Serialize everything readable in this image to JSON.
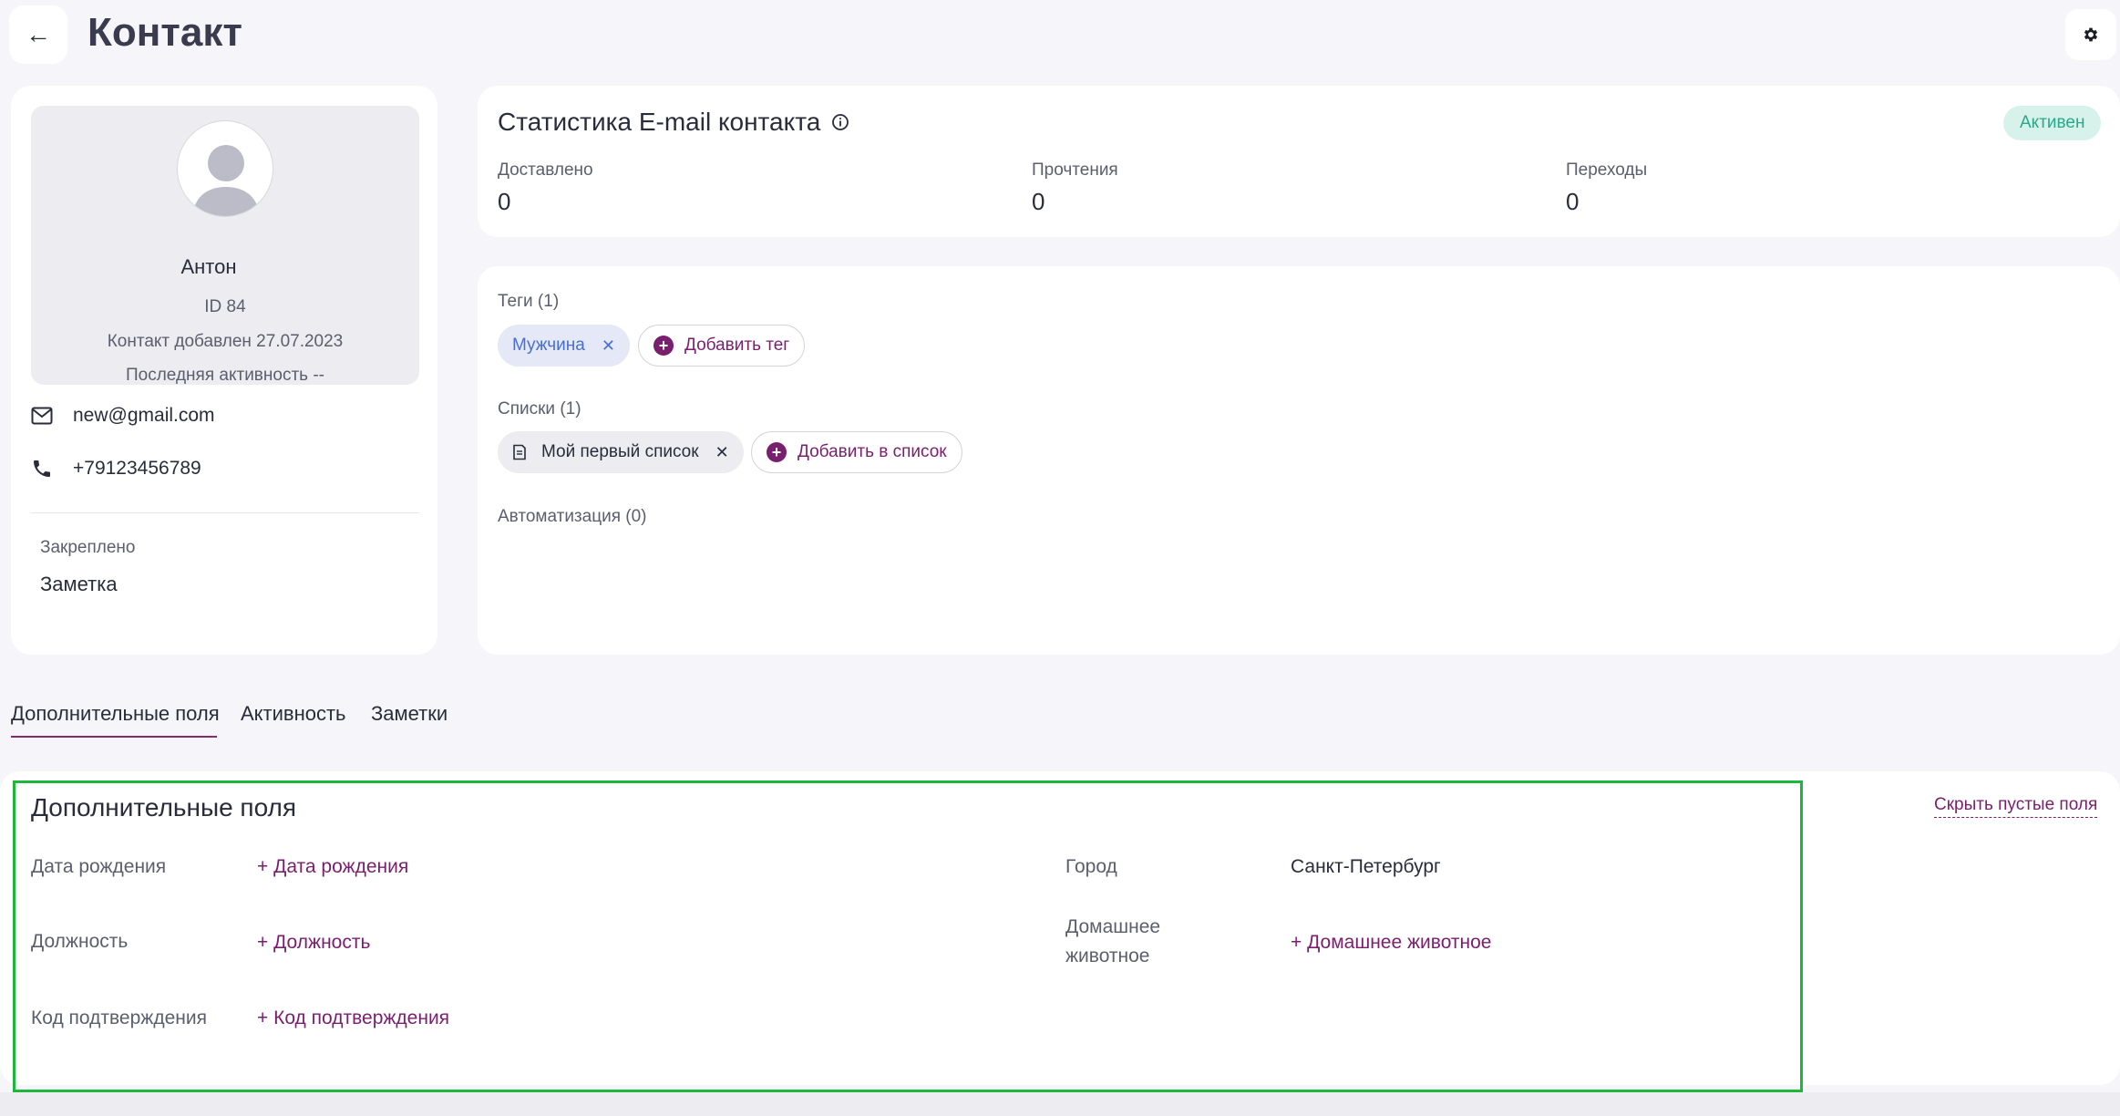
{
  "header": {
    "back_icon": "←",
    "title": "Контакт"
  },
  "profile": {
    "name": "Антон",
    "id": "ID 84",
    "added": "Контакт добавлен 27.07.2023",
    "last_activity": "Последняя активность --",
    "email": "new@gmail.com",
    "phone": "+79123456789",
    "pinned_label": "Закреплено",
    "pinned_value": "Заметка"
  },
  "stats": {
    "title": "Статистика E-mail контакта",
    "status": "Активен",
    "items": [
      {
        "label": "Доставлено",
        "value": "0"
      },
      {
        "label": "Прочтения",
        "value": "0"
      },
      {
        "label": "Переходы",
        "value": "0"
      }
    ]
  },
  "tags": {
    "label": "Теги (1)",
    "items": [
      "Мужчина"
    ],
    "add_label": "Добавить тег"
  },
  "lists": {
    "label": "Списки (1)",
    "items": [
      "Мой первый список"
    ],
    "add_label": "Добавить в список"
  },
  "automation": {
    "label": "Автоматизация (0)"
  },
  "tabs": [
    {
      "label": "Дополнительные поля",
      "active": true
    },
    {
      "label": "Активность"
    },
    {
      "label": "Заметки"
    }
  ],
  "extra_fields": {
    "title": "Дополнительные поля",
    "hide_empty": "Скрыть пустые поля",
    "birthday_label": "Дата рождения",
    "birthday_add": "+ Дата рождения",
    "position_label": "Должность",
    "position_add": "+ Должность",
    "code_label": "Код подтверждения",
    "code_add": "+ Код подтверждения",
    "city_label": "Город",
    "city_value": "Санкт-Петербург",
    "pet_label_line1": "Домашнее",
    "pet_label_line2": "животное",
    "pet_add": "+ Домашнее животное"
  },
  "colors": {
    "accent": "#7a1f6e",
    "highlight": "#1db83a",
    "active_badge_bg": "#d6f2ea",
    "active_badge_text": "#2aa98a",
    "tag_bg": "#e4e8f7",
    "tag_text": "#4a6fd0"
  }
}
